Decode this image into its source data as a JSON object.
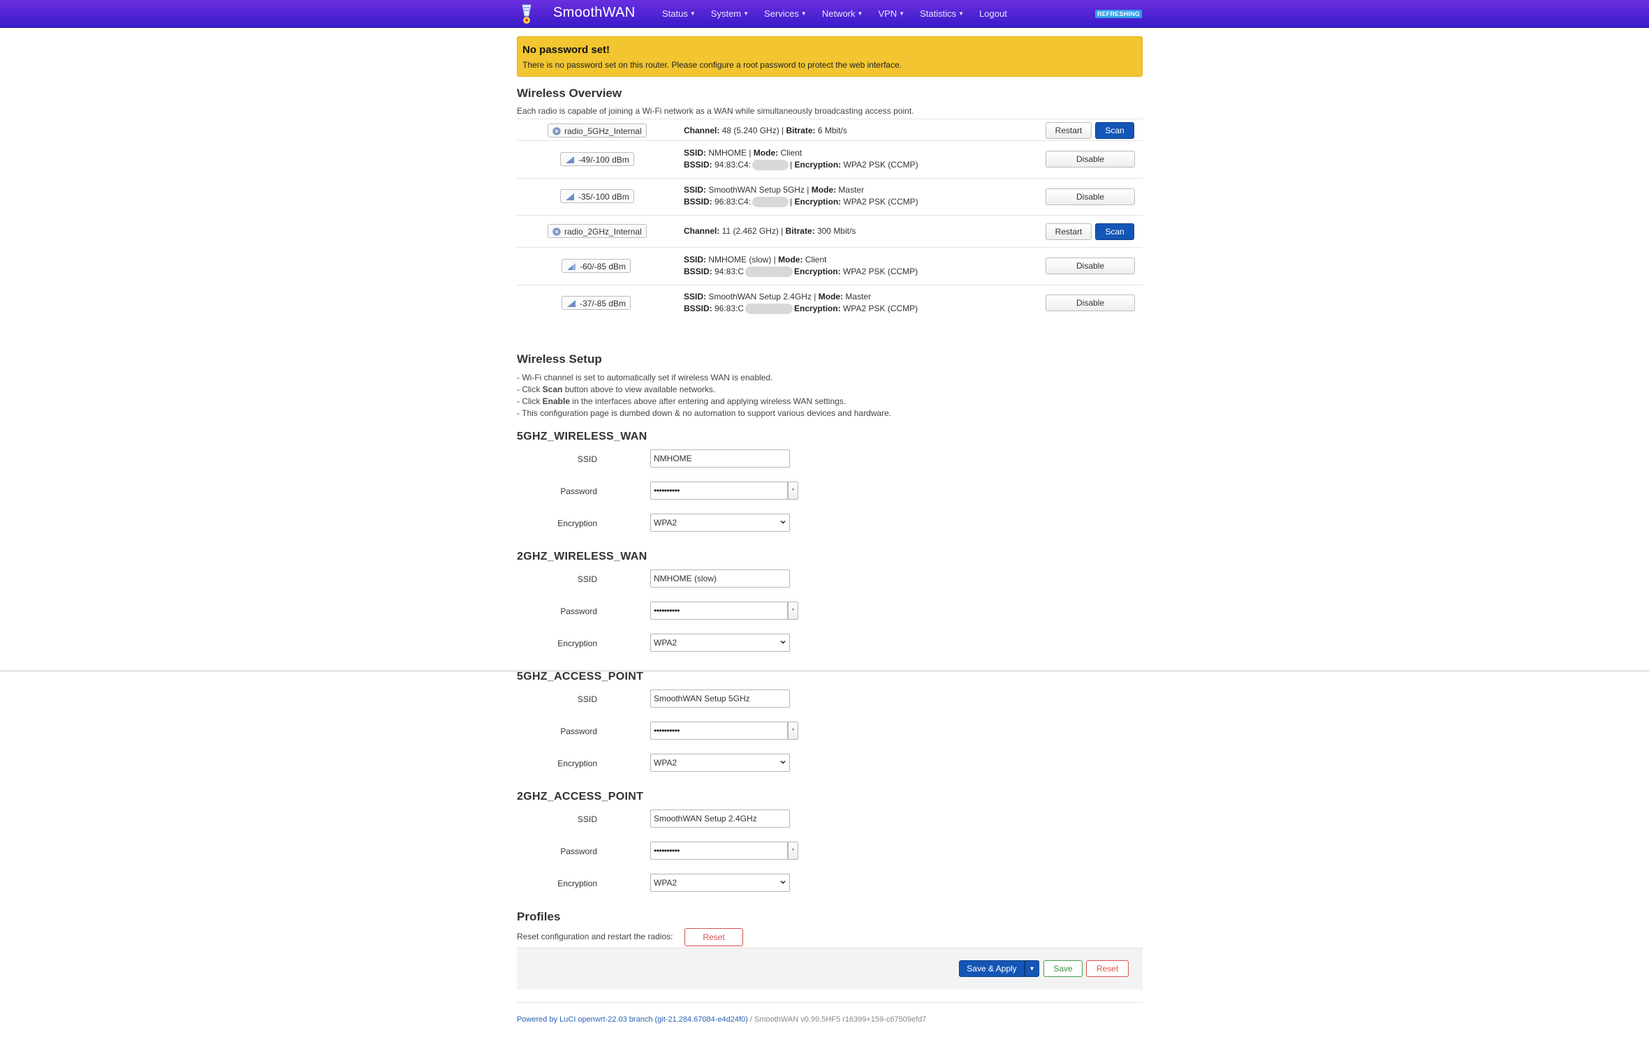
{
  "header": {
    "brand": "SmoothWAN",
    "nav": [
      {
        "label": "Status"
      },
      {
        "label": "System"
      },
      {
        "label": "Services"
      },
      {
        "label": "Network"
      },
      {
        "label": "VPN"
      },
      {
        "label": "Statistics"
      }
    ],
    "logout": "Logout",
    "refresh_badge": "REFRESHING",
    "colors": {
      "bar": "#4a22d4",
      "badge": "#2f9ee8"
    }
  },
  "alert": {
    "title": "No password set!",
    "text": "There is no password set on this router. Please configure a root password to protect the web interface.",
    "color": "#f2c531"
  },
  "overview": {
    "title": "Wireless Overview",
    "description": "Each radio is capable of joining a Wi-Fi network as a WAN while simultaneously broadcasting access point.",
    "radios": [
      {
        "name": "radio_5GHz_Internal",
        "channel_label": "Channel:",
        "channel": " 48 (5.240 GHz) | ",
        "bitrate_label": "Bitrate:",
        "bitrate": " 6 Mbit/s",
        "restart": "Restart",
        "scan": "Scan",
        "interfaces": [
          {
            "signal": "-49/-100 dBm",
            "ssid_label": "SSID:",
            "ssid": " NMHOME | ",
            "mode_label": "Mode:",
            "mode": " Client",
            "bssid_label": "BSSID:",
            "bssid": " 94:83:C4:",
            "enc_label": "Encryption:",
            "enc": " WPA2 PSK (CCMP)",
            "button": "Disable"
          },
          {
            "signal": "-35/-100 dBm",
            "ssid_label": "SSID:",
            "ssid": " SmoothWAN Setup 5GHz | ",
            "mode_label": "Mode:",
            "mode": " Master",
            "bssid_label": "BSSID:",
            "bssid": " 96:83:C4:",
            "enc_label": "Encryption:",
            "enc": " WPA2 PSK (CCMP)",
            "button": "Disable"
          }
        ]
      },
      {
        "name": "radio_2GHz_Internal",
        "channel_label": "Channel:",
        "channel": " 11 (2.462 GHz) | ",
        "bitrate_label": "Bitrate:",
        "bitrate": " 300 Mbit/s",
        "restart": "Restart",
        "scan": "Scan",
        "interfaces": [
          {
            "signal": "-60/-85 dBm",
            "ssid_label": "SSID:",
            "ssid": " NMHOME (slow) | ",
            "mode_label": "Mode:",
            "mode": " Client",
            "bssid_label": "BSSID:",
            "bssid": " 94:83:C",
            "enc_label": "Encryption:",
            "enc": " WPA2 PSK (CCMP)",
            "button": "Disable"
          },
          {
            "signal": "-37/-85 dBm",
            "ssid_label": "SSID:",
            "ssid": " SmoothWAN Setup 2.4GHz | ",
            "mode_label": "Mode:",
            "mode": " Master",
            "bssid_label": "BSSID:",
            "bssid": " 96:83:C",
            "enc_label": "Encryption:",
            "enc": " WPA2 PSK (CCMP)",
            "button": "Disable"
          }
        ]
      }
    ]
  },
  "setup": {
    "title": "Wireless Setup",
    "notes": [
      {
        "pre": "- Wi-Fi channel is set to automatically set if wireless WAN is enabled.",
        "bold": "",
        "post": ""
      },
      {
        "pre": "- Click ",
        "bold": "Scan",
        "post": " button above to view available networks."
      },
      {
        "pre": "- Click ",
        "bold": "Enable",
        "post": " in the interfaces above after entering and applying wireless WAN settings."
      },
      {
        "pre": "- This configuration page is dumbed down & no automation to support various devices and hardware.",
        "bold": "",
        "post": ""
      }
    ]
  },
  "sections": [
    {
      "title": "5GHZ_WIRELESS_WAN",
      "ssid_label": "SSID",
      "ssid": "NMHOME",
      "password_label": "Password",
      "password": "••••••••••",
      "encryption_label": "Encryption",
      "encryption": "WPA2"
    },
    {
      "title": "2GHZ_WIRELESS_WAN",
      "ssid_label": "SSID",
      "ssid": "NMHOME (slow)",
      "password_label": "Password",
      "password": "••••••••••",
      "encryption_label": "Encryption",
      "encryption": "WPA2"
    },
    {
      "title": "5GHZ_ACCESS_POINT",
      "ssid_label": "SSID",
      "ssid": "SmoothWAN Setup 5GHz",
      "password_label": "Password",
      "password": "••••••••••",
      "encryption_label": "Encryption",
      "encryption": "WPA2"
    },
    {
      "title": "2GHZ_ACCESS_POINT",
      "ssid_label": "SSID",
      "ssid": "SmoothWAN Setup 2.4GHz",
      "password_label": "Password",
      "password": "••••••••••",
      "encryption_label": "Encryption",
      "encryption": "WPA2"
    }
  ],
  "reveal_glyph": "*",
  "profiles": {
    "title": "Profiles",
    "text": "Reset configuration and restart the radios:",
    "reset": "Reset"
  },
  "actions": {
    "save_apply": "Save & Apply",
    "dropdown_glyph": "▾",
    "save": "Save",
    "reset": "Reset"
  },
  "footer": {
    "powered": "Powered by LuCI openwrt-22.03 branch (git-21.284.67084-e4d24f0)",
    "version": " / SmoothWAN v0.99.5HF5 r16399+159-c67509efd7"
  }
}
